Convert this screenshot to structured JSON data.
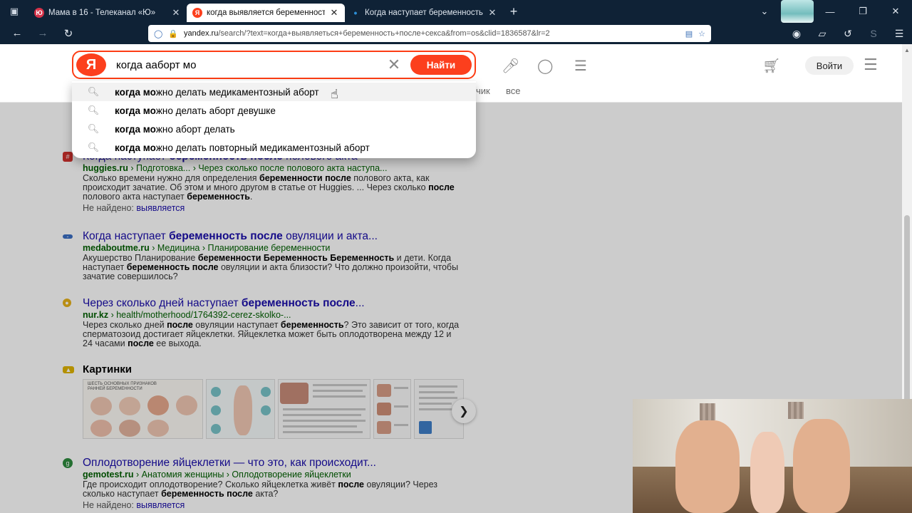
{
  "browser": {
    "tabs": [
      {
        "title": "Мама в 16 - Телеканал «Ю»",
        "active": false,
        "favicon_color": "#d6334a",
        "favicon_glyph": "Ю"
      },
      {
        "title": "когда выявляется беременность",
        "active": true,
        "favicon_color": "#fc3f1d",
        "favicon_glyph": "Я"
      },
      {
        "title": "Когда наступает беременность",
        "active": false,
        "favicon_color": "#2c8ed6",
        "favicon_glyph": "•"
      }
    ],
    "url_domain": "yandex.ru",
    "url_path": "/search/?text=когда+выявляеться+беременность+после+секса&from=os&clid=1836587&lr=2"
  },
  "search": {
    "query": "когда ааборт мо",
    "find_label": "Найти",
    "login_label": "Войти",
    "tab_partial_1": "чик",
    "tab_partial_2": "все"
  },
  "suggestions": [
    {
      "bold": "когда мо",
      "rest": "жно делать медикаментозный аборт"
    },
    {
      "bold": "когда мо",
      "rest": "жно делать аборт девушке"
    },
    {
      "bold": "когда мо",
      "rest": "жно аборт делать"
    },
    {
      "bold": "когда мо",
      "rest": "жно делать повторный медикаментозный аборт"
    }
  ],
  "results": [
    {
      "favicon_color": "#d0312d",
      "title_pre": "Когда наступает ",
      "title_bold": "беременность после",
      "title_post": " полового акта",
      "url_domain": "huggies.ru",
      "url_path": " › Подготовка... › Через сколько после полового акта наступа...",
      "snippet_parts": [
        {
          "t": "Сколько времени нужно для определения ",
          "b": false
        },
        {
          "t": "беременности после",
          "b": true
        },
        {
          "t": " полового акта, как происходит зачатие. Об этом и много другом в статье от Huggies. ... Через сколько ",
          "b": false
        },
        {
          "t": "после",
          "b": true
        },
        {
          "t": " полового акта наступает ",
          "b": false
        },
        {
          "t": "беременность",
          "b": true
        },
        {
          "t": ".",
          "b": false
        }
      ],
      "not_found_label": "Не найдено:",
      "not_found_word": "выявляется"
    },
    {
      "favicon_color": "#3a6fc4",
      "title_pre": "Когда наступает ",
      "title_bold": "беременность после",
      "title_post": " овуляции и акта...",
      "url_domain": "medaboutme.ru",
      "url_path": " › Медицина › Планирование беременности",
      "snippet_parts": [
        {
          "t": "Акушерство Планирование ",
          "b": false
        },
        {
          "t": "беременности Беременность Беременность",
          "b": true
        },
        {
          "t": " и дети. Когда наступает ",
          "b": false
        },
        {
          "t": "беременность после",
          "b": true
        },
        {
          "t": " овуляции и акта близости? Что должно произойти, чтобы зачатие совершилось?",
          "b": false
        }
      ]
    },
    {
      "favicon_color": "#e8b21a",
      "title_pre": "Через сколько дней наступает ",
      "title_bold": "беременность после",
      "title_post": "...",
      "url_domain": "nur.kz",
      "url_path": " › health/motherhood/1764392-cerez-skolko-...",
      "snippet_parts": [
        {
          "t": "Через сколько дней ",
          "b": false
        },
        {
          "t": "после",
          "b": true
        },
        {
          "t": " овуляции наступает ",
          "b": false
        },
        {
          "t": "беременность",
          "b": true
        },
        {
          "t": "? Это зависит от того, когда сперматозоид достигает яйцеклетки. Яйцеклетка может быть оплодотворена между 12 и 24 часами ",
          "b": false
        },
        {
          "t": "после",
          "b": true
        },
        {
          "t": " ее выхода.",
          "b": false
        }
      ]
    },
    {
      "favicon_color": "#2e8b3e",
      "title_pre": "Оплодотворение яйцеклетки — что это, как происходит...",
      "title_bold": "",
      "title_post": "",
      "url_domain": "gemotest.ru",
      "url_path": " › Анатомия женщины › Оплодотворение яйцеклетки",
      "snippet_parts": [
        {
          "t": "Где происходит оплодотворение? Сколько яйцеклетка живёт ",
          "b": false
        },
        {
          "t": "после",
          "b": true
        },
        {
          "t": " овуляции? Через сколько наступает ",
          "b": false
        },
        {
          "t": "беременность после",
          "b": true
        },
        {
          "t": " акта?",
          "b": false
        }
      ],
      "not_found_label": "Не найдено:",
      "not_found_word": "выявляется"
    }
  ],
  "images": {
    "title": "Картинки",
    "thumb_caption": "ШЕСТЬ ОСНОВНЫХ ПРИЗНАКОВ РАННЕЙ БЕРЕМЕННОСТИ"
  },
  "colors": {
    "yandex_red": "#fc3f1d",
    "link_blue": "#1a0dab",
    "url_green": "#006000",
    "chrome_dark": "#0f2236"
  }
}
